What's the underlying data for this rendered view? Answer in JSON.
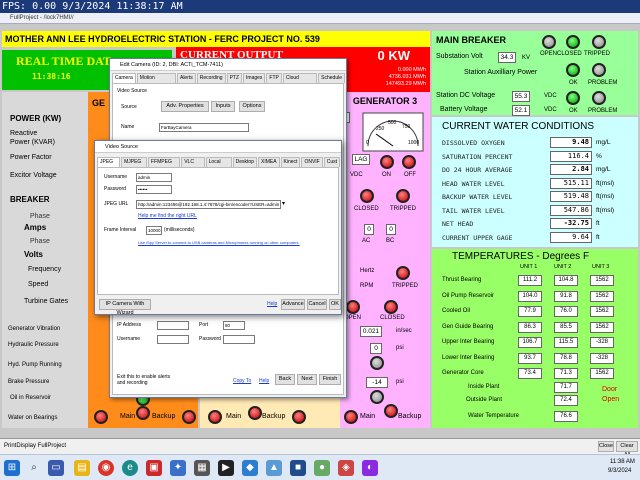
{
  "fps_overlay": "FPS: 0.00 9/3/2024 11:38:17 AM",
  "app_title": "FullProject - /lock7HMI//",
  "station_title": "MOTHER ANN LEE HYDROELECTRIC STATION - FERC PROJECT NO. 539",
  "real_time": {
    "label": "REAL TIME DAT",
    "clock": "11:38:16"
  },
  "current_output": {
    "label": "CURRENT OUTPUT",
    "kw": "0 KW",
    "mwh1": "0.000 MWh",
    "mwh2": "4736.031 MWh",
    "mwh3": "147493.29 MWh"
  },
  "left_labels": {
    "power": "POWER (KW)",
    "reactive": "Reactive",
    "reactive2": "Power (KVAR)",
    "pf": "Power Factor",
    "excitor": "Excitor Voltage",
    "breaker": "BREAKER",
    "phase": "Phase",
    "amps": "Amps",
    "phase2": "Phase",
    "volts": "Volts",
    "frequency": "Frequency",
    "speed": "Speed",
    "turbine": "Turbine Gates",
    "gen_vib": "Generator Vibration",
    "hyd_press": "Hydraulic Pressure",
    "hyd_pump": "Hyd. Pump Running",
    "brake": "Brake Pressure",
    "oil_res": "Oil in Reservoir",
    "water_brg": "Water on Bearings"
  },
  "gen_labels": {
    "ge": "GE",
    "gen3": "GENERATOR 3",
    "lag": "LAG",
    "vdc": "VDC",
    "on": "ON",
    "off": "OFF",
    "closed": "CLOSED",
    "tripped": "TRIPPED",
    "ac": "AC",
    "bc": "BC",
    "hertz": "Hertz",
    "rpm": "RPM",
    "tripped2": "TRIPPED",
    "open": "OPEN",
    "closed2": "CLOSED",
    "in_sec": "in/sec",
    "psi": "psi",
    "psi2": "psi",
    "main": "Main",
    "backup": "Backup",
    "main2": "Main",
    "backup2": "Backup",
    "main3": "Main",
    "backup3": "Backup",
    "b": "B",
    "zero1": "0",
    "zero2": "0",
    "zero3": "0",
    "v0": "0",
    "v0021": "0.021",
    "vneg14": "-14"
  },
  "main_breaker": {
    "title": "MAIN BREAKER",
    "sub_volt_label": "Substation Volt",
    "sub_volt": "34.3",
    "kv": "KV",
    "aux_power": "Station Auxilliary Power",
    "open": "OPEN",
    "closed": "CLOSED",
    "tripped": "TRIPPED",
    "ok": "OK",
    "problem": "PROBLEM",
    "dc_label": "Station DC Voltage",
    "dc": "55.3",
    "vdc": "VDC",
    "batt_label": "Battery Voltage",
    "batt": "52.1",
    "vdc2": "VDC",
    "ok2": "OK",
    "problem2": "PROBLEM"
  },
  "water": {
    "title": "CURRENT WATER CONDITIONS",
    "rows": [
      {
        "label": "DISSOLVED OXYGEN",
        "value": "9.48",
        "unit": "mg/L"
      },
      {
        "label": "SATURATION PERCENT",
        "value": "116.4",
        "unit": "%"
      },
      {
        "label": "DO 24 HOUR AVERAGE",
        "value": "2.84",
        "unit": "mg/L"
      },
      {
        "label": "HEAD WATER LEVEL",
        "value": "515.11",
        "unit": "ft(msl)"
      },
      {
        "label": "BACKUP WATER LEVEL",
        "value": "519.48",
        "unit": "ft(msl)"
      },
      {
        "label": "TAIL WATER LEVEL",
        "value": "547.86",
        "unit": "ft(msl)"
      },
      {
        "label": "NET HEAD",
        "value": "-32.75",
        "unit": "ft"
      },
      {
        "label": "CURRENT UPPER GAGE",
        "value": "9.64",
        "unit": "ft"
      }
    ]
  },
  "temps": {
    "title": "TEMPERATURES - Degrees F",
    "cols": [
      "UNIT 1",
      "UNIT 2",
      "UNIT 3"
    ],
    "rows": [
      {
        "label": "Thrust Bearing",
        "v": [
          "111.2",
          "104.8",
          "1562"
        ]
      },
      {
        "label": "Oil Pump Reservoir",
        "v": [
          "104.0",
          "91.8",
          "1562"
        ]
      },
      {
        "label": "Cooled Oil",
        "v": [
          "77.9",
          "76.0",
          "1562"
        ]
      },
      {
        "label": "Gen Guide Bearing",
        "v": [
          "86.3",
          "85.5",
          "1562"
        ]
      },
      {
        "label": "Upper Inter Bearing",
        "v": [
          "106.7",
          "115.5",
          "-328"
        ]
      },
      {
        "label": "Lower Inter Bearing",
        "v": [
          "93.7",
          "78.8",
          "-328"
        ]
      },
      {
        "label": "Generator Core",
        "v": [
          "73.4",
          "71.3",
          "1562"
        ]
      }
    ],
    "inside_label": "Inside Plant",
    "inside": "71.7",
    "outside_label": "Outside Plant",
    "outside": "72.4",
    "water_label": "Water Temperature",
    "water": "76.6",
    "door": "Door",
    "door_state": "Open"
  },
  "camera_dialog": {
    "title": "Edit Camera (ID: 2, DBI: ACTi_TCM-7411)",
    "tabs": [
      "Camera",
      "Motion Detection",
      "Alerts",
      "Recording",
      "PTZ",
      "Images",
      "FTP",
      "Cloud Storage",
      "Schedule"
    ],
    "video_source": "Video Source",
    "source_label": "Source",
    "adv_props": "Adv. Properties",
    "inputs": "Inputs",
    "options": "Options",
    "name_label": "Name",
    "name_value": "FarBayCamera",
    "ip_label": "IP Address",
    "port_label": "Port",
    "port_value": "80",
    "user_label": "Username",
    "pass_label": "Password",
    "exit_note": "Exit this to enable alerts and recording",
    "copy": "Copy To",
    "help": "Help",
    "back": "Back",
    "next": "Next",
    "finish": "Finish"
  },
  "video_dialog": {
    "title": "Video Source",
    "tabs": [
      "JPEG URL",
      "MJPEG URL",
      "FFMPEG (H264)",
      "VLC Plugin",
      "Local Device",
      "Desktop",
      "XIMEA",
      "Kinect",
      "ONVIF",
      "Cust"
    ],
    "username_label": "Username",
    "username": "admin",
    "password_label": "Password",
    "password": "••••••",
    "jpeg_label": "JPEG URL",
    "jpeg_url": "http://admin:123456@192.168.1.4:7878/cgi-bin/encoder?USER=admin",
    "help_link": "Help me find the right URL",
    "interval_label": "Frame Interval",
    "interval": "10000",
    "interval_unit": "(milliseconds)",
    "ispy_link": "Use iSpy Server to connect to USB cameras and Microphones running on other computers.",
    "wizard": "IP Camera With Wizard",
    "help": "Help",
    "advance": "Advance",
    "cancel": "Cancel",
    "ok": "OK"
  },
  "status": {
    "print_label": "PrintDisplay FullProject",
    "close": "Close",
    "clear_all": "Clear All"
  },
  "taskbar": {
    "time": "11:38 AM",
    "date": "9/3/2024"
  }
}
